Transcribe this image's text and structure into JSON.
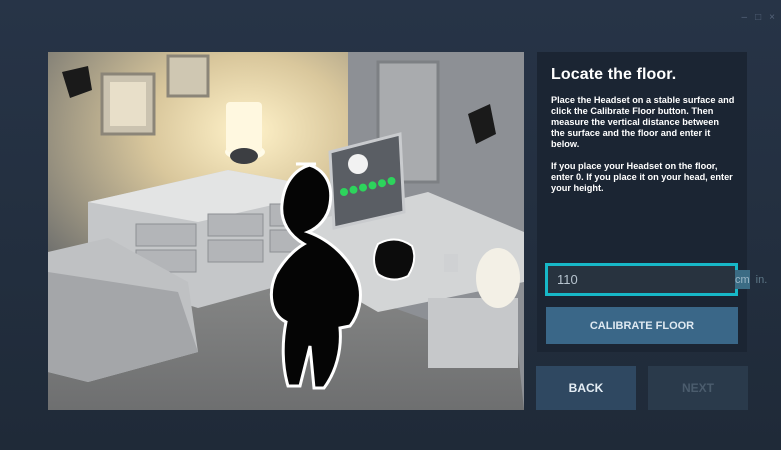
{
  "window": {
    "controls": {
      "minimize": "–",
      "maximize": "□",
      "close": "×"
    }
  },
  "scene": {
    "description_icons": [
      "headset-icon",
      "person-silhouette"
    ],
    "status_lights_on": 6
  },
  "panel": {
    "title": "Locate the floor.",
    "paragraphs": [
      "Place the Headset on a stable surface and click the Calibrate Floor button. Then measure the vertical distance between the surface and the floor and enter it below.",
      "If you place your Headset on the floor, enter 0. If you place it on your head, enter your height."
    ]
  },
  "height_input": {
    "value": "110",
    "unit_cm": "cm",
    "unit_in": "in.",
    "selected_unit": "cm"
  },
  "buttons": {
    "calibrate": "CALIBRATE FLOOR",
    "back": "BACK",
    "next": "NEXT"
  },
  "colors": {
    "highlight": "#17b8c8",
    "button_primary": "#3a6788",
    "status_light": "#2dd45c"
  }
}
